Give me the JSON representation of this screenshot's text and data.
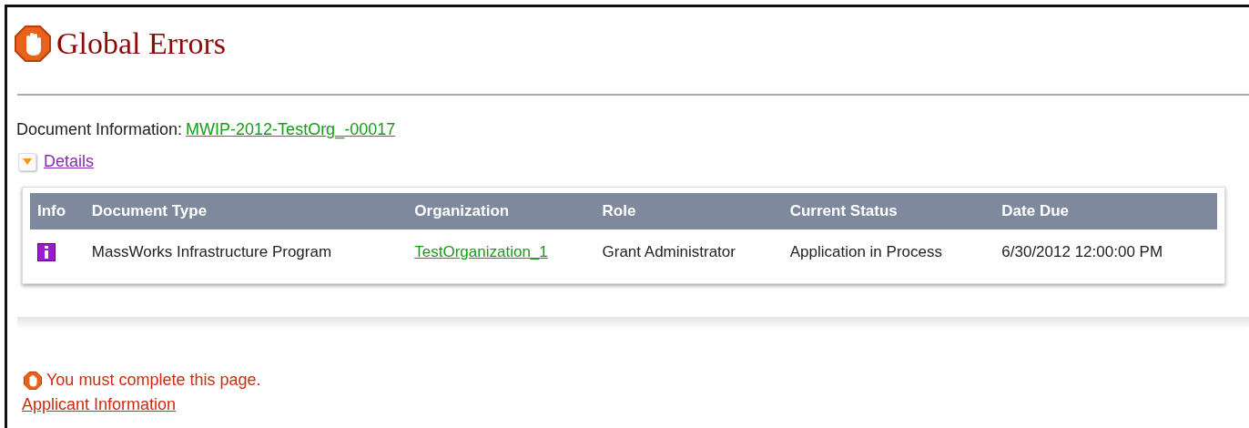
{
  "title": "Global Errors",
  "document_information": {
    "label": "Document Information:",
    "link": "MWIP-2012-TestOrg_-00017"
  },
  "details": {
    "label": "Details",
    "expanded": true
  },
  "table": {
    "columns": [
      "Info",
      "Document Type",
      "Organization",
      "Role",
      "Current Status",
      "Date Due"
    ],
    "rows": [
      {
        "document_type": "MassWorks Infrastructure Program",
        "organization": "TestOrganization_1",
        "role": "Grant Administrator",
        "current_status": "Application in Process",
        "date_due": "6/30/2012 12:00:00 PM"
      }
    ]
  },
  "errors": [
    {
      "message": "You must complete this page.",
      "link": "Applicant Information"
    }
  ]
}
